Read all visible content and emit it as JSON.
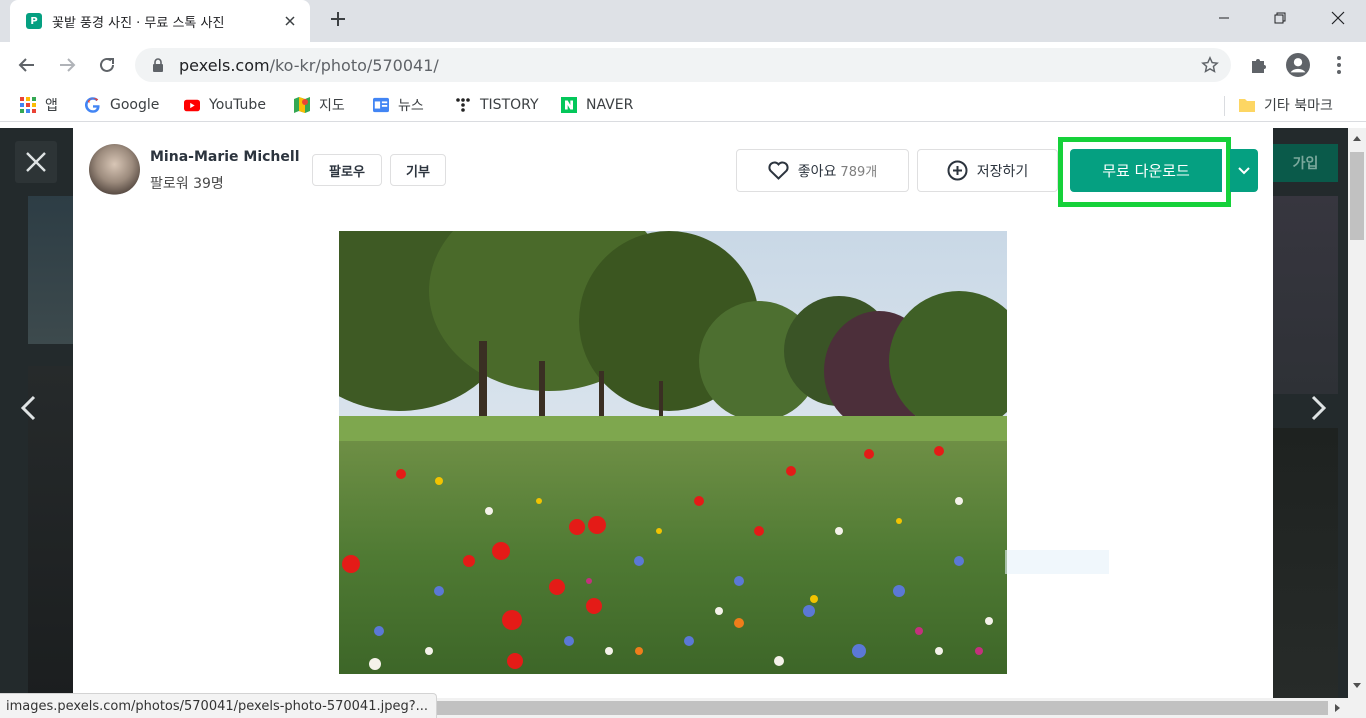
{
  "browser": {
    "tab": {
      "title": "꽃밭 풍경 사진 · 무료 스톡 사진",
      "favicon_letter": "P"
    },
    "url": {
      "domain": "pexels.com",
      "path": "/ko-kr/photo/570041/"
    },
    "bookmarks": [
      {
        "label": "앱",
        "icon": "apps-grid-icon"
      },
      {
        "label": "Google",
        "icon": "google-icon"
      },
      {
        "label": "YouTube",
        "icon": "youtube-icon"
      },
      {
        "label": "지도",
        "icon": "maps-icon"
      },
      {
        "label": "뉴스",
        "icon": "news-icon"
      },
      {
        "label": "TISTORY",
        "icon": "tistory-icon"
      },
      {
        "label": "NAVER",
        "icon": "naver-icon"
      }
    ],
    "other_bookmarks": "기타 북마크",
    "status_url": "images.pexels.com/photos/570041/pexels-photo-570041.jpeg?..."
  },
  "background": {
    "join_label": "가입"
  },
  "modal": {
    "author": {
      "name": "Mina-Marie Michell",
      "followers": "팔로워 39명"
    },
    "follow_label": "팔로우",
    "donate_label": "기부",
    "like_label": "좋아요",
    "like_count": "789개",
    "save_label": "저장하기",
    "download_label": "무료 다운로드"
  },
  "colors": {
    "accent": "#05a081",
    "highlight": "#15d13a",
    "page_bg": "#232a2c"
  }
}
